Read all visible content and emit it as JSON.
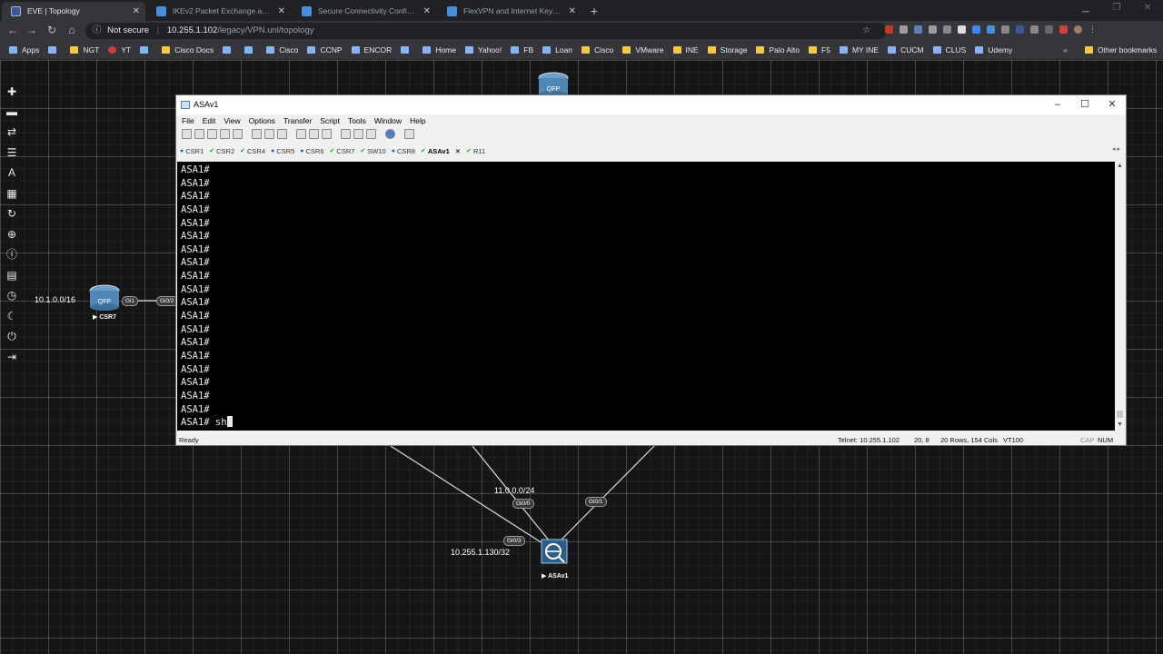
{
  "browser": {
    "tabs": [
      {
        "title": "EVE | Topology",
        "active": true
      },
      {
        "title": "IKEv2 Packet Exchange and Proto",
        "active": false
      },
      {
        "title": "Secure Connectivity Configuratio",
        "active": false
      },
      {
        "title": "FlexVPN and Internet Key Exchan",
        "active": false
      }
    ],
    "address": {
      "security_label": "Not secure",
      "host": "10.255.1.102",
      "path": "/legacy/VPN.unl/topology"
    },
    "bookmarks": [
      {
        "label": "Apps",
        "icon": "apps-icon"
      },
      {
        "label": "",
        "icon": "site-icon"
      },
      {
        "label": "NGT",
        "icon": "folder-icon"
      },
      {
        "label": "YT",
        "icon": "youtube-icon"
      },
      {
        "label": "",
        "icon": "site-icon"
      },
      {
        "label": "Cisco Docs",
        "icon": "folder-icon"
      },
      {
        "label": "",
        "icon": "site-icon"
      },
      {
        "label": "",
        "icon": "site-icon"
      },
      {
        "label": "Cisco",
        "icon": "site-icon"
      },
      {
        "label": "CCNP",
        "icon": "site-icon"
      },
      {
        "label": "ENCOR",
        "icon": "site-icon"
      },
      {
        "label": "",
        "icon": "site-icon"
      },
      {
        "label": "Home",
        "icon": "site-icon"
      },
      {
        "label": "Yahoo!",
        "icon": "yahoo-icon"
      },
      {
        "label": "FB",
        "icon": "facebook-icon"
      },
      {
        "label": "Loan",
        "icon": "site-icon"
      },
      {
        "label": "Cisco",
        "icon": "folder-icon"
      },
      {
        "label": "VMware",
        "icon": "folder-icon"
      },
      {
        "label": "INE",
        "icon": "folder-icon"
      },
      {
        "label": "Storage",
        "icon": "folder-icon"
      },
      {
        "label": "Palo Alto",
        "icon": "folder-icon"
      },
      {
        "label": "F5",
        "icon": "folder-icon"
      },
      {
        "label": "MY INE",
        "icon": "site-icon"
      },
      {
        "label": "CUCM",
        "icon": "site-icon"
      },
      {
        "label": "CLUS",
        "icon": "site-icon"
      },
      {
        "label": "Udemy",
        "icon": "site-icon"
      }
    ],
    "bookmarks_more": "»",
    "other_bookmarks": "Other bookmarks"
  },
  "topology": {
    "network_label_left": "10.1.0.0/16",
    "csr7_ports": [
      "Gi1",
      "Gi0/2"
    ],
    "csr7_label": "▶ CSR7",
    "asav1_label": "▶ ASAv1",
    "network_label_mid": "11.0.0.0/24",
    "asav1_ports": [
      "Gi0/0",
      "Gi0/1",
      "Gi0/3"
    ],
    "mgmt_label": "10.255.1.130/32",
    "top_node_icon": "QFP"
  },
  "crt": {
    "title": "ASAv1",
    "menu": [
      "File",
      "Edit",
      "View",
      "Options",
      "Transfer",
      "Script",
      "Tools",
      "Window",
      "Help"
    ],
    "tabs": [
      {
        "label": "CSR1",
        "status": "info"
      },
      {
        "label": "CSR2",
        "status": "ok"
      },
      {
        "label": "CSR4",
        "status": "ok"
      },
      {
        "label": "CSR5",
        "status": "info"
      },
      {
        "label": "CSR6",
        "status": "info"
      },
      {
        "label": "CSR7",
        "status": "ok"
      },
      {
        "label": "SW10",
        "status": "ok"
      },
      {
        "label": "CSR8",
        "status": "info"
      },
      {
        "label": "ASAv1",
        "status": "ok",
        "active": true
      },
      {
        "label": "R11",
        "status": "ok"
      }
    ],
    "terminal_lines": [
      "ASA1#",
      "ASA1#",
      "ASA1#",
      "ASA1#",
      "ASA1#",
      "ASA1#",
      "ASA1#",
      "ASA1#",
      "ASA1#",
      "ASA1#",
      "ASA1#",
      "ASA1#",
      "ASA1#",
      "ASA1#",
      "ASA1#",
      "ASA1#",
      "ASA1#",
      "ASA1#",
      "ASA1#"
    ],
    "current_prompt": "ASA1# sh",
    "status": {
      "ready": "Ready",
      "connection": "Telnet: 10.255.1.102",
      "cursor_pos": "20,  8",
      "size": "20 Rows, 154 Cols",
      "emulation": "VT100",
      "cap": "CAP",
      "num": "NUM"
    }
  }
}
